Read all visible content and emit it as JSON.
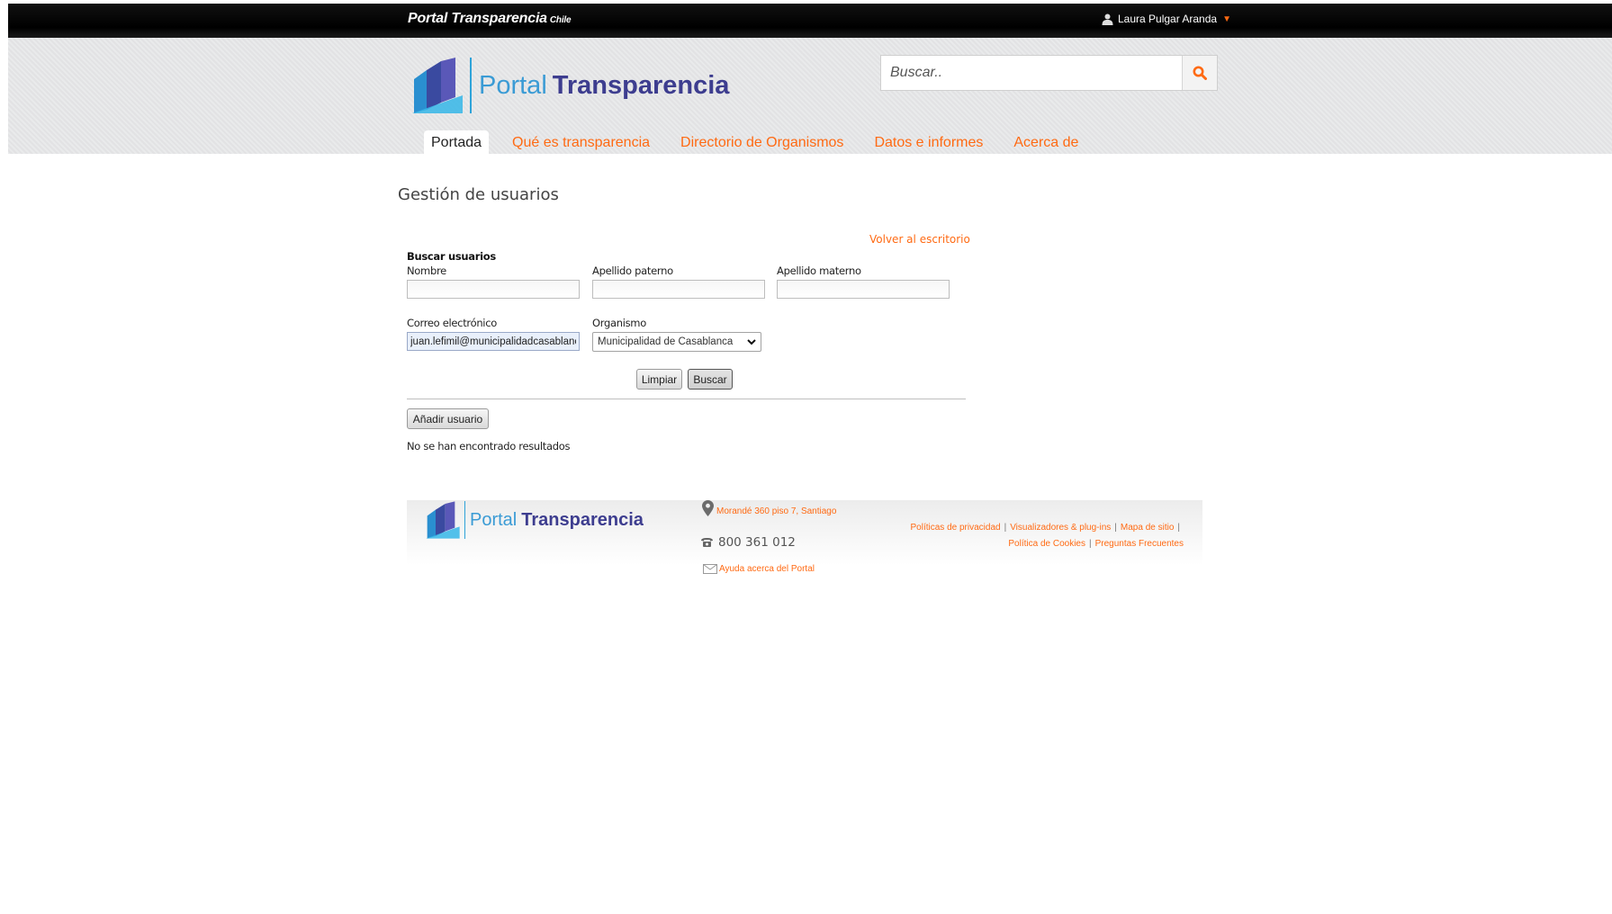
{
  "topbar": {
    "brand": "Portal Transparencia",
    "brand_suffix": "Chile",
    "user_name": "Laura Pulgar Aranda"
  },
  "header": {
    "logo_light": "Portal",
    "logo_bold": "Transparencia",
    "search_placeholder": "Buscar..",
    "nav": [
      {
        "label": "Portada",
        "active": true
      },
      {
        "label": "Qué es transparencia",
        "active": false
      },
      {
        "label": "Directorio de Organismos",
        "active": false
      },
      {
        "label": "Datos e informes",
        "active": false
      },
      {
        "label": "Acerca de",
        "active": false
      }
    ]
  },
  "main": {
    "page_title": "Gestión de usuarios",
    "back_link": "Volver al escritorio",
    "section_label": "Buscar usuarios",
    "fields": {
      "nombre_label": "Nombre",
      "nombre_value": "",
      "apellido_paterno_label": "Apellido paterno",
      "apellido_paterno_value": "",
      "apellido_materno_label": "Apellido materno",
      "apellido_materno_value": "",
      "correo_label": "Correo electrónico",
      "correo_value": "juan.lefimil@municipalidadcasablanca",
      "organismo_label": "Organismo",
      "organismo_value": "Municipalidad de Casablanca"
    },
    "clear_button": "Limpiar",
    "search_button": "Buscar",
    "add_user_button": "Añadir usuario",
    "no_results": "No se han encontrado resultados"
  },
  "footer": {
    "logo_light": "Portal",
    "logo_bold": "Transparencia",
    "address": "Morandé 360 piso 7, Santiago",
    "phone": "800 361 012",
    "help": "Ayuda acerca del Portal",
    "links_row1": [
      "Políticas de privacidad",
      "Visualizadores & plug-ins",
      "Mapa de sitio"
    ],
    "links_row2": [
      "Política de Cookies",
      "Preguntas Frecuentes"
    ]
  },
  "colors": {
    "accent": "#ff6a13",
    "brand_blue": "#3d3d8f",
    "brand_light_blue": "#3a9bd5"
  }
}
